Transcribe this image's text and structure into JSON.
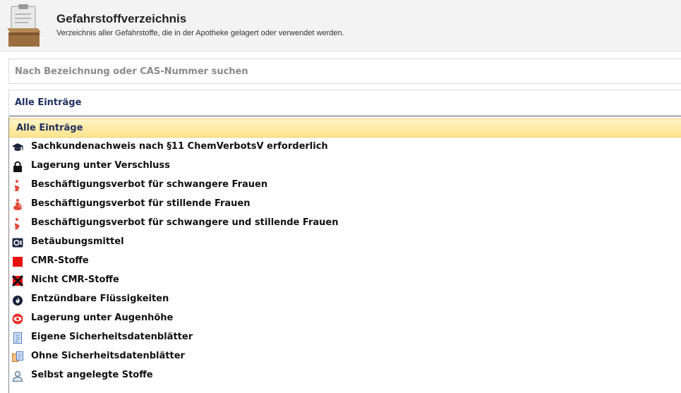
{
  "header": {
    "title": "Gefahrstoffverzeichnis",
    "subtitle": "Verzeichnis aller Gefahrstoffe, die in der Apotheke gelagert oder verwendet werden.",
    "icon": "clipboard-box-icon"
  },
  "search": {
    "placeholder": "Nach Bezeichnung oder CAS-Nummer suchen",
    "value": ""
  },
  "filter": {
    "selected": "Alle Einträge",
    "options": [
      {
        "label": "Alle Einträge",
        "icon": "",
        "selected": true
      },
      {
        "label": "Sachkundenachweis nach §11 ChemVerbotsV erforderlich",
        "icon": "graduation-cap-icon"
      },
      {
        "label": "Lagerung unter Verschluss",
        "icon": "padlock-icon"
      },
      {
        "label": "Beschäftigungsverbot für schwangere Frauen",
        "icon": "pregnant-woman-icon"
      },
      {
        "label": "Beschäftigungsverbot für stillende Frauen",
        "icon": "nursing-woman-icon"
      },
      {
        "label": "Beschäftigungsverbot für schwangere und stillende Frauen",
        "icon": "pregnant-woman-icon"
      },
      {
        "label": "Betäubungsmittel",
        "icon": "narcotics-safe-icon"
      },
      {
        "label": "CMR-Stoffe",
        "icon": "red-square-icon"
      },
      {
        "label": "Nicht CMR-Stoffe",
        "icon": "crossed-red-square-icon"
      },
      {
        "label": "Entzündbare Flüssigkeiten",
        "icon": "flame-icon"
      },
      {
        "label": "Lagerung unter Augenhöhe",
        "icon": "eye-icon"
      },
      {
        "label": "Eigene Sicherheitsdatenblätter",
        "icon": "document-icon"
      },
      {
        "label": "Ohne Sicherheitsdatenblätter",
        "icon": "documents-missing-icon"
      },
      {
        "label": "Selbst angelegte Stoffe",
        "icon": "user-icon"
      }
    ]
  },
  "colors": {
    "selected_bg": "#fde48c",
    "selected_text": "#1d2f5f",
    "cmr_red": "#e8120c",
    "pregnancy_red": "#e24a3a"
  }
}
